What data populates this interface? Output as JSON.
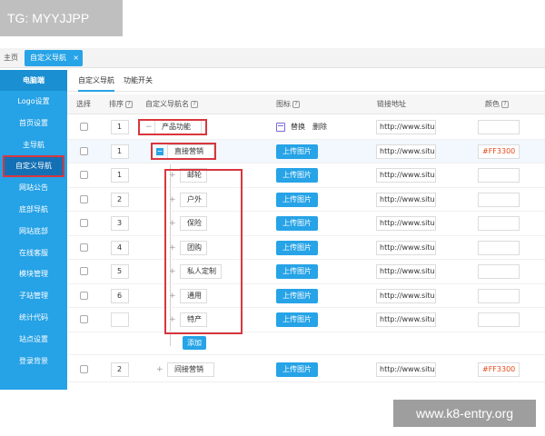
{
  "watermark_top": "TG: MYYJJPP",
  "watermark_bottom": "www.k8-entry.org",
  "tabs": {
    "home": "主页",
    "active": "自定义导航",
    "close": "×"
  },
  "sidebar": {
    "header": "电脑端",
    "items": [
      "Logo设置",
      "首页设置",
      "主导航",
      "自定义导航",
      "网站公告",
      "底部导航",
      "网站底部",
      "在线客服",
      "模块管理",
      "子站管理",
      "统计代码",
      "站点设置",
      "登录背景"
    ]
  },
  "subtabs": [
    "自定义导航",
    "功能开关"
  ],
  "columns": {
    "select": "选择",
    "order": "排序",
    "name": "自定义导航名",
    "icon": "图标",
    "url": "链接地址",
    "color": "颜色",
    "help": "?"
  },
  "icon_actions": {
    "replace": "替换",
    "delete": "删除"
  },
  "upload_label": "上传图片",
  "add_label": "添加",
  "rows": [
    {
      "order": "1",
      "name": "产品功能",
      "url": "http://www.situ",
      "color": "",
      "level": 0,
      "mode": "icon"
    },
    {
      "order": "1",
      "name": "直接营销",
      "url": "http://www.situ",
      "color": "#FF3300",
      "level": 1,
      "mode": "upload"
    },
    {
      "order": "1",
      "name": "邮轮",
      "url": "http://www.situ",
      "color": "",
      "level": 2,
      "mode": "upload"
    },
    {
      "order": "2",
      "name": "户外",
      "url": "http://www.situ",
      "color": "",
      "level": 2,
      "mode": "upload"
    },
    {
      "order": "3",
      "name": "保险",
      "url": "http://www.situ",
      "color": "",
      "level": 2,
      "mode": "upload"
    },
    {
      "order": "4",
      "name": "团购",
      "url": "http://www.situ",
      "color": "",
      "level": 2,
      "mode": "upload"
    },
    {
      "order": "5",
      "name": "私人定制",
      "url": "http://www.situ",
      "color": "",
      "level": 2,
      "mode": "upload"
    },
    {
      "order": "6",
      "name": "通用",
      "url": "http://www.situ",
      "color": "",
      "level": 2,
      "mode": "upload"
    },
    {
      "order": "",
      "name": "特产",
      "url": "http://www.situ",
      "color": "",
      "level": 2,
      "mode": "upload"
    },
    {
      "order": "2",
      "name": "间接营销",
      "url": "http://www.situ",
      "color": "#FF3300",
      "level": 1,
      "mode": "upload"
    }
  ]
}
